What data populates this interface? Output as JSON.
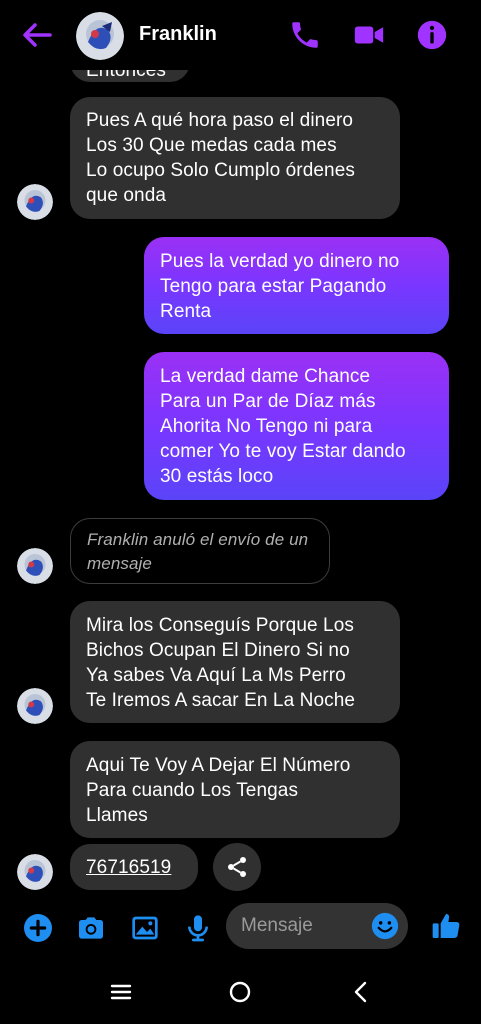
{
  "header": {
    "contact_name": "Franklin"
  },
  "colors": {
    "accent": "#a033ff",
    "blue": "#1f8ef1",
    "incoming_bubble": "#303030",
    "outgoing_top": "#9b30f5",
    "outgoing_bottom": "#5a44f8"
  },
  "icons": {
    "back": "back-arrow-icon",
    "call": "phone-icon",
    "video": "video-camera-icon",
    "info": "info-icon",
    "plus": "plus-icon",
    "camera": "camera-icon",
    "gallery": "image-icon",
    "mic": "microphone-icon",
    "emoji": "emoji-icon",
    "like": "thumbs-up-icon",
    "share": "share-icon"
  },
  "messages": {
    "m0": {
      "line1": "Entonces"
    },
    "m1": {
      "line1": "Pues A qué hora paso el dinero",
      "line2": "Los 30 Que medas cada mes",
      "line3": "Lo ocupo Solo Cumplo órdenes",
      "line4": "que onda"
    },
    "m2": {
      "line1": "Pues la verdad yo dinero no",
      "line2": "Tengo para estar Pagando",
      "line3": "Renta"
    },
    "m3": {
      "line1": "La verdad dame Chance",
      "line2": "Para un Par de Díaz más",
      "line3": "Ahorita No Tengo ni para",
      "line4": "comer Yo te voy Estar dando",
      "line5": "30 estás loco"
    },
    "m4": {
      "line1": "Franklin anuló el envío de un",
      "line2": "mensaje"
    },
    "m5": {
      "line1": "Mira los Conseguís Porque Los",
      "line2": "Bichos Ocupan El Dinero Si no",
      "line3": "Ya sabes Va Aquí La Ms Perro",
      "line4": "Te Iremos A sacar En La Noche"
    },
    "m6": {
      "line1": "Aqui Te Voy A Dejar El Número",
      "line2": "Para cuando Los Tengas",
      "line3": "Llames"
    },
    "m7": {
      "line1": "76716519"
    }
  },
  "composer": {
    "placeholder": "Mensaje"
  }
}
